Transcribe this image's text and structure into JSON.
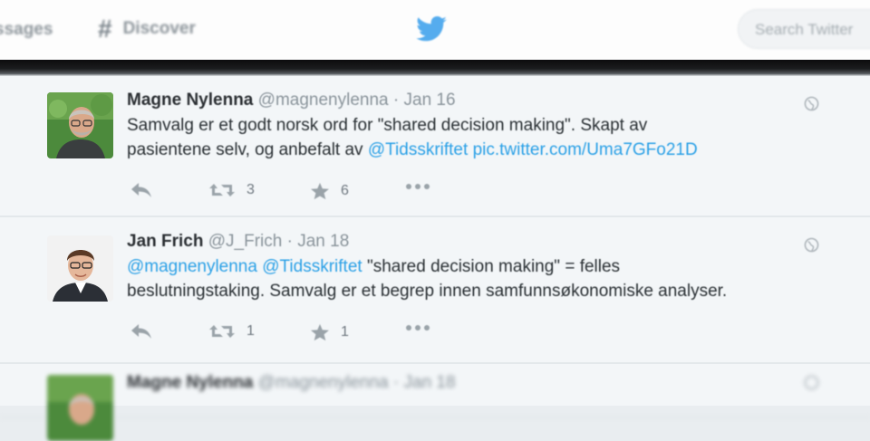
{
  "nav": {
    "messages_label": "ssages",
    "discover_label": "Discover",
    "search_placeholder": "Search Twitter"
  },
  "tweets": [
    {
      "name": "Magne Nylenna",
      "handle": "@magnenylenna",
      "date": "· Jan 16",
      "text_line1": "Samvalg er et godt norsk ord for \"shared decision making\". Skapt av",
      "text_line2_plain": "pasientene selv, og anbefalt av ",
      "mention": "@Tidsskriftet",
      "pic_link": "pic.twitter.com/Uma7GFo21D",
      "retweets": "3",
      "favorites": "6"
    },
    {
      "name": "Jan Frich",
      "handle": "@J_Frich",
      "date": "· Jan 18",
      "mention1": "@magnenylenna",
      "mention2": "@Tidsskriftet",
      "text_line1_plain": "\"shared decision making\" = felles",
      "text_line2": "beslutningstaking. Samvalg er et begrep innen samfunnsøkonomiske analyser.",
      "retweets": "1",
      "favorites": "1"
    },
    {
      "name": "Magne Nylenna",
      "handle": "@magnenylenna",
      "date": "· Jan 18"
    }
  ],
  "colors": {
    "link": "#2aa0e6",
    "twitter_blue": "#55acee",
    "timeline_bg": "#f3f6f8"
  }
}
